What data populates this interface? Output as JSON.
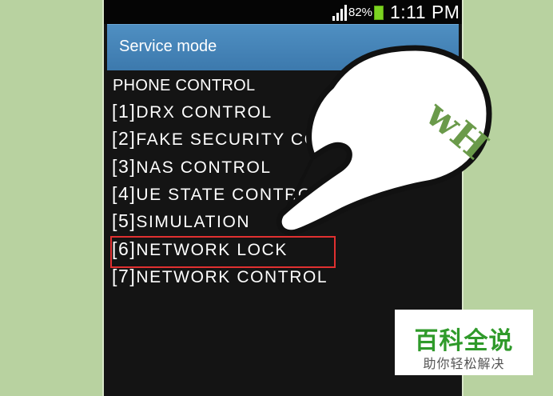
{
  "status_bar": {
    "battery_percent": "82%",
    "time": "1:11 PM"
  },
  "app": {
    "title": "Service mode"
  },
  "menu": {
    "header": "PHONE CONTROL",
    "items": [
      {
        "number": "[1]",
        "label": "DRX CONTROL"
      },
      {
        "number": "[2]",
        "label": "FAKE SECURITY CONTROL"
      },
      {
        "number": "[3]",
        "label": "NAS CONTROL"
      },
      {
        "number": "[4]",
        "label": "UE STATE CONTROL"
      },
      {
        "number": "[5]",
        "label": "SIMULATION"
      },
      {
        "number": "[6]",
        "label": "NETWORK LOCK"
      },
      {
        "number": "[7]",
        "label": "NETWORK CONTROL"
      }
    ],
    "highlighted_index": 5,
    "highlight_color": "#e03030"
  },
  "overlay": {
    "hand_logo_text": "wH"
  },
  "watermark": {
    "main": "百科全说",
    "sub": "助你轻松解决"
  },
  "colors": {
    "background": "#b8d2a0",
    "titlebar": "#3c79ad",
    "screen": "#141414",
    "watermark_green": "#2f9a2a"
  }
}
